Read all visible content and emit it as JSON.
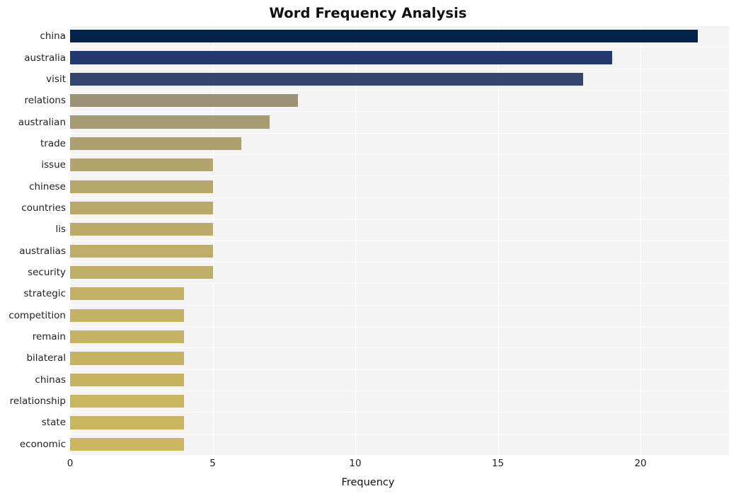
{
  "chart_data": {
    "type": "bar",
    "orientation": "horizontal",
    "title": "Word Frequency Analysis",
    "xlabel": "Frequency",
    "ylabel": "",
    "categories": [
      "china",
      "australia",
      "visit",
      "relations",
      "australian",
      "trade",
      "issue",
      "chinese",
      "countries",
      "lis",
      "australias",
      "security",
      "strategic",
      "competition",
      "remain",
      "bilateral",
      "chinas",
      "relationship",
      "state",
      "economic"
    ],
    "values": [
      22,
      19,
      18,
      8,
      7,
      6,
      5,
      5,
      5,
      5,
      5,
      5,
      4,
      4,
      4,
      4,
      4,
      4,
      4,
      4
    ],
    "bar_colors": [
      "#03234b",
      "#22386f",
      "#344470",
      "#9a9378",
      "#a69c73",
      "#ab9f6f",
      "#b3a56c",
      "#b6a76b",
      "#b8a96a",
      "#bbab69",
      "#bdad68",
      "#bfae67",
      "#c1b065",
      "#c3b164",
      "#c5b263",
      "#c6b362",
      "#c7b461",
      "#c8b560",
      "#c9b660",
      "#cab75f"
    ],
    "xlim": [
      0,
      23.1
    ],
    "xticks": [
      0,
      5,
      10,
      15,
      20
    ],
    "xtick_labels": [
      "0",
      "5",
      "10",
      "15",
      "20"
    ],
    "grid": true,
    "grid_axis": "both",
    "legend": "none",
    "plot_background": "#f4f4f5",
    "figure_background": "#ffffff",
    "title_color": "#111111",
    "tick_label_color": "#222222"
  }
}
